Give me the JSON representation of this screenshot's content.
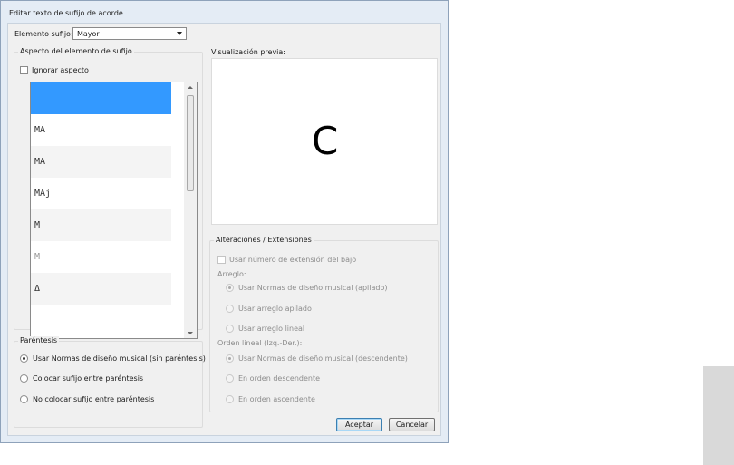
{
  "dialog": {
    "title": "Editar texto de sufijo de acorde",
    "suffix_label": "Elemento sufijo:",
    "suffix_value": "Mayor",
    "appearance": {
      "legend": "Aspecto del elemento de sufijo",
      "ignore_label": "Ignorar aspecto",
      "items": [
        "",
        "MA",
        "MA",
        "MAj",
        "M",
        "M",
        "Δ"
      ]
    },
    "preview": {
      "legend": "Visualización previa:",
      "symbol": "C"
    },
    "parentheses": {
      "legend": "Paréntesis",
      "options": [
        "Usar Normas de diseño musical (sin paréntesis)",
        "Colocar sufijo entre paréntesis",
        "No colocar sufijo entre paréntesis"
      ],
      "selected": 0
    },
    "alterations": {
      "legend": "Alteraciones / Extensiones",
      "bass_ext_label": "Usar número de extensión del bajo",
      "arrangement_label": "Arreglo:",
      "arrangement_options": [
        "Usar Normas de diseño musical (apilado)",
        "Usar arreglo apilado",
        "Usar arreglo lineal"
      ],
      "order_label": "Orden lineal (Izq.-Der.):",
      "order_options": [
        "Usar Normas de diseño musical (descendente)",
        "En orden descendente",
        "En orden ascendente"
      ]
    },
    "buttons": {
      "ok": "Aceptar",
      "cancel": "Cancelar"
    }
  }
}
